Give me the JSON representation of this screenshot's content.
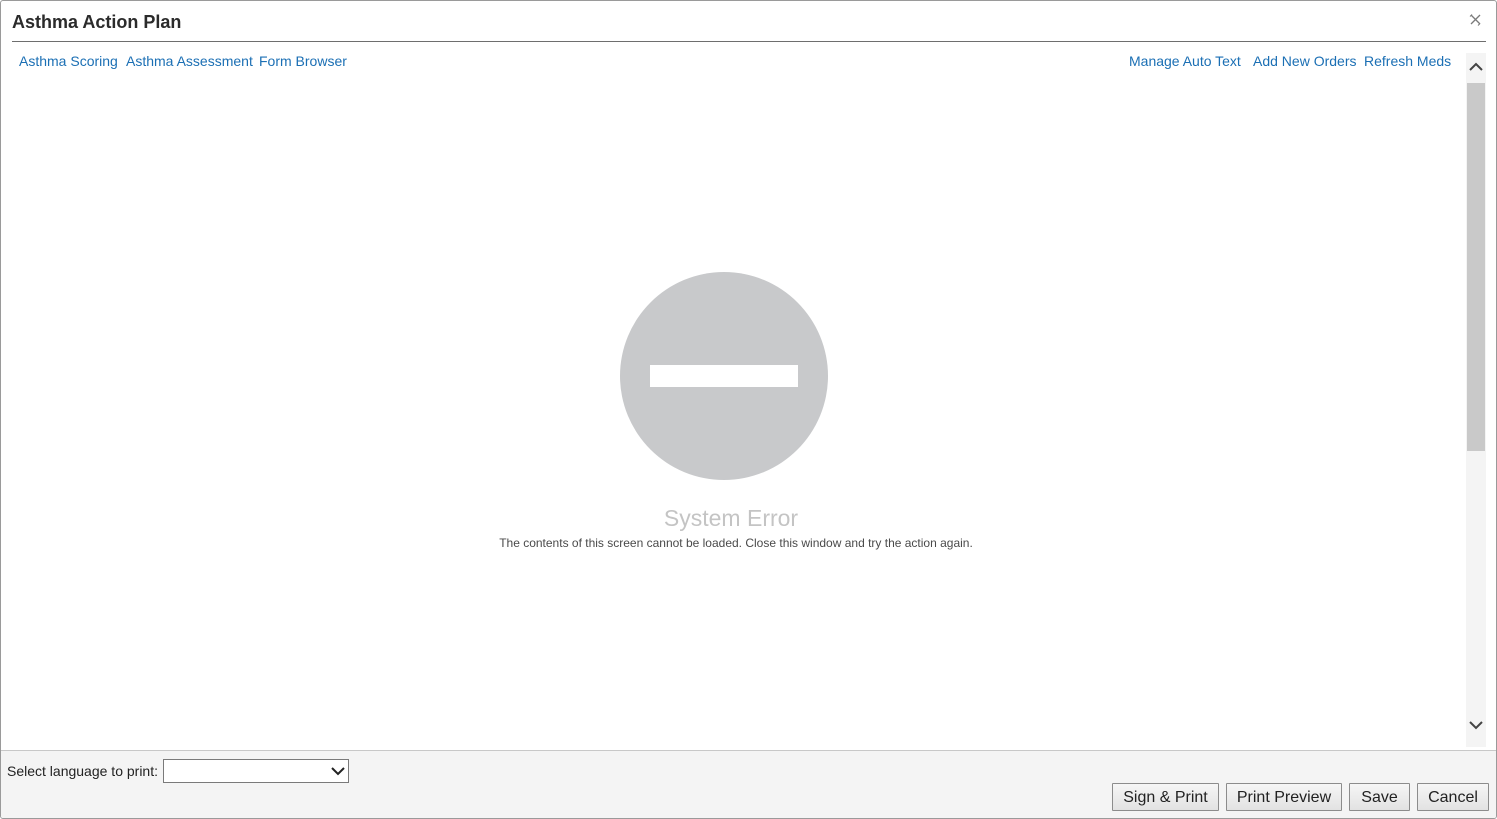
{
  "window": {
    "title": "Asthma Action Plan",
    "close_icon": "close-x-icon"
  },
  "nav_left": [
    {
      "label": "Asthma Scoring"
    },
    {
      "label": "Asthma Assessment"
    },
    {
      "label": "Form Browser"
    }
  ],
  "nav_right": [
    {
      "label": "Manage Auto Text"
    },
    {
      "label": "Add New Orders"
    },
    {
      "label": "Refresh Meds"
    }
  ],
  "error": {
    "icon": "no-entry-icon",
    "title": "System Error",
    "message": "The contents of this screen cannot be loaded. Close this window and try the action again."
  },
  "footer": {
    "language_label": "Select language to print:",
    "language_value": "",
    "buttons": {
      "sign_print": "Sign & Print",
      "print_preview": "Print Preview",
      "save": "Save",
      "cancel": "Cancel"
    }
  },
  "colors": {
    "link": "#1b6fb4",
    "error_icon": "#c8c9cb",
    "error_title": "#c4c4c4"
  }
}
